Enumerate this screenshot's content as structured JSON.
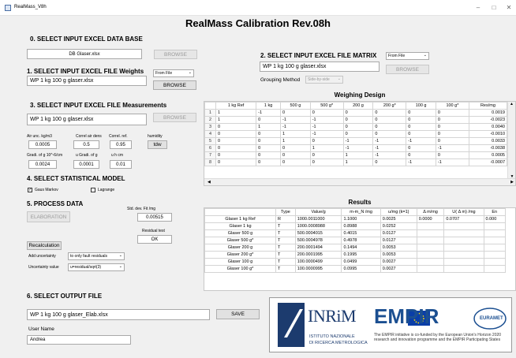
{
  "window": {
    "title": "RealMass_V8h",
    "minimize": "–",
    "maximize": "□",
    "close": "✕"
  },
  "main_title": "RealMass Calibration Rev.08h",
  "sec0": {
    "title": "0. SELECT INPUT EXCEL DATA BASE",
    "file": "DB Glaser.xlsx",
    "browse": "BROWSE"
  },
  "sec1": {
    "title": "1. SELECT INPUT EXCEL FILE Weights",
    "file": "WP 1 kg 100 g glaser.xlsx",
    "source": "From File",
    "browse": "BROWSE"
  },
  "sec2": {
    "title": "2. SELECT INPUT EXCEL FILE MATRIX",
    "file": "WP 1 kg 100 g glaser.xlsx",
    "source": "From File",
    "browse": "BROWSE",
    "grouping_label": "Grouping Method",
    "grouping_value": "Side-by-side"
  },
  "sec3": {
    "title": "3. SELECT INPUT EXCEL FILE Measurements",
    "file": "WP 1 kg 100 g glaser.xlsx",
    "browse": "BROWSE",
    "params": [
      {
        "label": "Air unc. kg/m3",
        "value": "0.0005"
      },
      {
        "label": "Correl air dens",
        "value": "0.5"
      },
      {
        "label": "Correl. ref.",
        "value": "0.95"
      },
      {
        "label": "humidity",
        "value": "tdw"
      },
      {
        "label": "Gradi. of g 10^-6/cm",
        "value": "0.0024"
      },
      {
        "label": "u Gradi. of g",
        "value": "0.0001"
      },
      {
        "label": "u h cm",
        "value": "0.01"
      }
    ]
  },
  "sec4": {
    "title": "4. SELECT STATISTICAL MODEL",
    "gauss_markov": "Gaus Markov",
    "lagrange": "Lagrange",
    "gauss_checked": "✓"
  },
  "sec5": {
    "title": "5. PROCESS DATA",
    "elaboration": "ELABORATION",
    "std_dev_label": "Std. dev. Fit /mg",
    "std_dev_value": "0.00515",
    "residual_label": "Residual test",
    "residual_value": "OK",
    "recalculation": "Recalculation",
    "add_unc_label": "Add uncertainty",
    "add_unc_value": "to only fault residuals",
    "unc_value_label": "Uncertainty value",
    "unc_value_value": "u=residual/sqrt(3)"
  },
  "sec6": {
    "title": "6. SELECT OUTPUT FILE",
    "file": "WP 1 kg 100 g glaser_Elab.xlsx",
    "save": "SAVE",
    "user_label": "User Name",
    "user_value": "Andrea"
  },
  "design": {
    "title": "Weighing Design",
    "columns": [
      "1 kg Ref",
      "1 kg",
      "500 g",
      "500 g*",
      "200 g",
      "200 g*",
      "100 g",
      "100 g*",
      "Res/mg"
    ],
    "rows": [
      [
        "1",
        "-1",
        "0",
        "0",
        "0",
        "0",
        "0",
        "0",
        "0.0019"
      ],
      [
        "1",
        "0",
        "-1",
        "-1",
        "0",
        "0",
        "0",
        "0",
        "-0.0023"
      ],
      [
        "0",
        "1",
        "-1",
        "-1",
        "0",
        "0",
        "0",
        "0",
        "0.0040"
      ],
      [
        "0",
        "0",
        "1",
        "-1",
        "0",
        "0",
        "0",
        "0",
        "-0.0010"
      ],
      [
        "0",
        "0",
        "1",
        "0",
        "-1",
        "-1",
        "-1",
        "0",
        "0.0033"
      ],
      [
        "0",
        "0",
        "0",
        "1",
        "-1",
        "-1",
        "0",
        "-1",
        "-0.0038"
      ],
      [
        "0",
        "0",
        "0",
        "0",
        "1",
        "-1",
        "0",
        "0",
        "0.0005"
      ],
      [
        "0",
        "0",
        "0",
        "0",
        "1",
        "0",
        "-1",
        "-1",
        "-0.0007"
      ]
    ]
  },
  "results": {
    "title": "Results",
    "columns": [
      "Type",
      "Value/g",
      "m-m_N /mg",
      "u/mg (k=1)",
      "Δ m/mg",
      "U( Δ m) /mg",
      "En"
    ],
    "rows": [
      [
        "Glaser 1 kg Ref",
        "R",
        "1000.0011000",
        "1.1000",
        "0.0025",
        "0.0000",
        "0.0707",
        "0.000"
      ],
      [
        "Glaser 1 kg",
        "T",
        "1000.0008988",
        "0.8988",
        "0.0252",
        "",
        "",
        ""
      ],
      [
        "Glaser 500 g",
        "T",
        "500.0004015",
        "0.4015",
        "0.0127",
        "",
        "",
        ""
      ],
      [
        "Glaser 500 g*",
        "T",
        "500.0004978",
        "0.4978",
        "0.0127",
        "",
        "",
        ""
      ],
      [
        "Glaser 200 g",
        "T",
        "200.0001494",
        "0.1494",
        "0.0053",
        "",
        "",
        ""
      ],
      [
        "Glaser 200 g*",
        "T",
        "200.0001995",
        "0.1995",
        "0.0053",
        "",
        "",
        ""
      ],
      [
        "Glaser 100 g",
        "T",
        "100.0000499",
        "0.0499",
        "0.0027",
        "",
        "",
        ""
      ],
      [
        "Glaser 100 g*",
        "T",
        "100.0000995",
        "0.0995",
        "0.0027",
        "",
        "",
        ""
      ]
    ]
  },
  "logos": {
    "inrim": "INRiM",
    "inrim_sub1": "ISTITUTO NAZIONALE",
    "inrim_sub2": "DI RICERCA METROLOGICA",
    "empir": "EMPIR",
    "euramet": "EURAMET",
    "empir_note": "The EMPIR initiative is co-funded by the European Union's Horizon 2020 research and innovation programme and the EMPIR Participating States"
  },
  "colors": {
    "inrim_blue": "#1c3b6e",
    "empir_blue": "#1b4f91",
    "eu_blue": "#0a3ea8",
    "eu_star": "#ffdd00"
  }
}
